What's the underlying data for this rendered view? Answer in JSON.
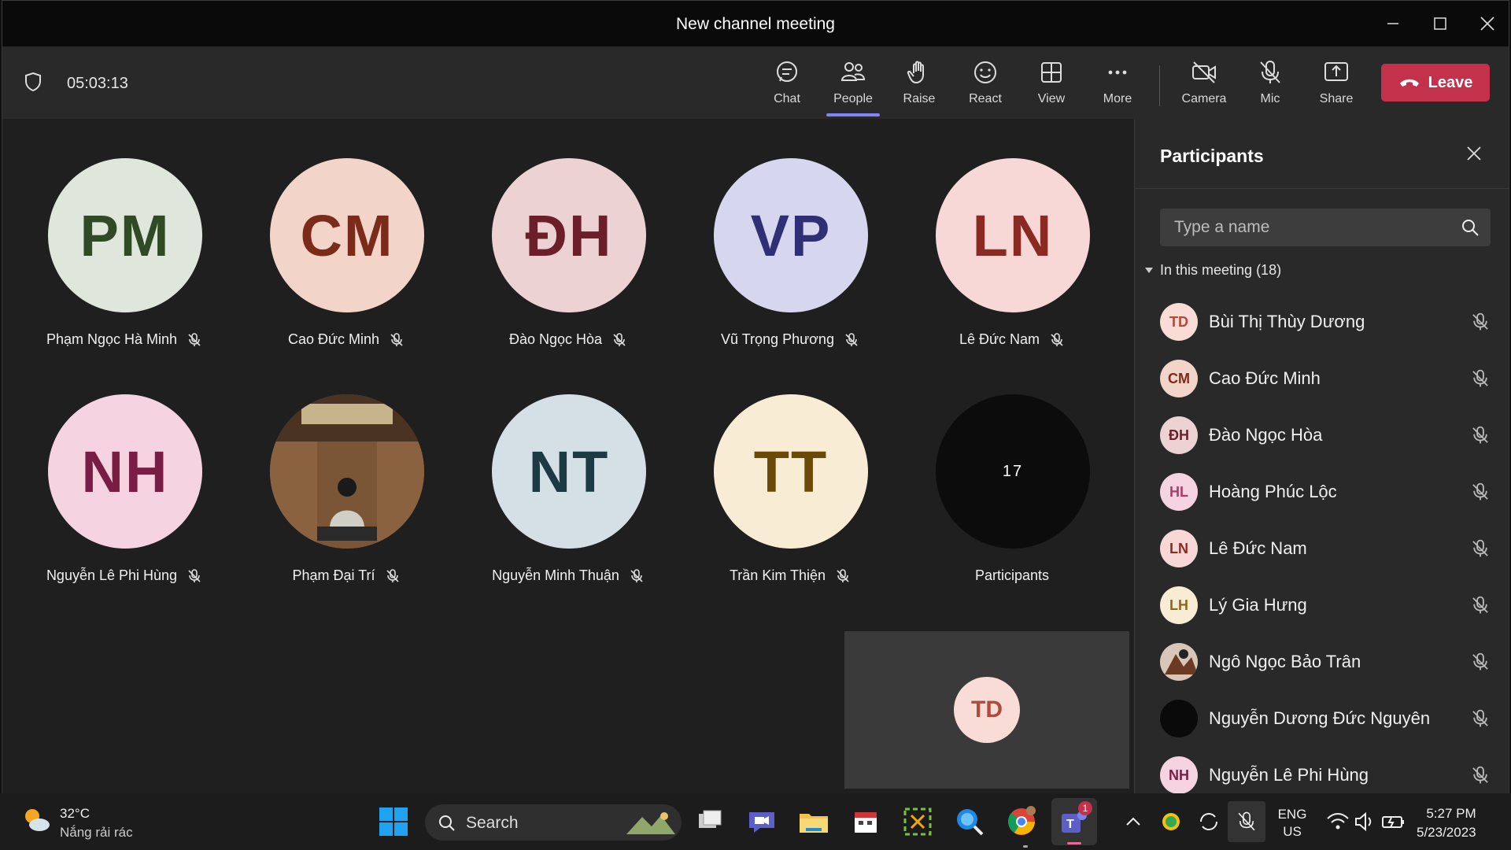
{
  "window": {
    "title": "New channel meeting"
  },
  "toolbar": {
    "timer": "05:03:13",
    "buttons": [
      {
        "label": "Chat",
        "icon": "chat-icon"
      },
      {
        "label": "People",
        "icon": "people-icon"
      },
      {
        "label": "Raise",
        "icon": "hand-icon"
      },
      {
        "label": "React",
        "icon": "smile-icon"
      },
      {
        "label": "View",
        "icon": "grid-icon"
      },
      {
        "label": "More",
        "icon": "more-icon"
      },
      {
        "label": "Camera",
        "icon": "camera-off-icon"
      },
      {
        "label": "Mic",
        "icon": "mic-off-icon"
      },
      {
        "label": "Share",
        "icon": "share-icon"
      }
    ],
    "leave_label": "Leave"
  },
  "stage": {
    "tiles": [
      {
        "initials": "PM",
        "name": "Phạm Ngọc Hà Minh",
        "bg": "#dfe6dc",
        "fg": "#2f4a24"
      },
      {
        "initials": "CM",
        "name": "Cao Đức Minh",
        "bg": "#f3d4c9",
        "fg": "#7a2b19"
      },
      {
        "initials": "ĐH",
        "name": "Đào Ngọc Hòa",
        "bg": "#ecd2d3",
        "fg": "#6a1f2a"
      },
      {
        "initials": "VP",
        "name": "Vũ Trọng Phương",
        "bg": "#d6d6ee",
        "fg": "#2f2f75"
      },
      {
        "initials": "LN",
        "name": "Lê Đức Nam",
        "bg": "#f8d8d6",
        "fg": "#8a2a22"
      },
      {
        "initials": "NH",
        "name": "Nguyễn Lê Phi Hùng",
        "bg": "#f6d3e1",
        "fg": "#7a1d44"
      },
      {
        "initials": "",
        "name": "Phạm Đại Trí",
        "bg": "#6b4a2e",
        "fg": "#fff"
      },
      {
        "initials": "NT",
        "name": "Nguyễn Minh Thuận",
        "bg": "#d4e0e6",
        "fg": "#1c3a44"
      },
      {
        "initials": "TT",
        "name": "Trần Kim Thiện",
        "bg": "#f8ecd4",
        "fg": "#6a4a06"
      },
      {
        "initials": "17",
        "name": "Participants",
        "bg": "#0c0c0c",
        "fg": "#fff"
      }
    ],
    "self_initials": "TD"
  },
  "panel": {
    "title": "Participants",
    "search_placeholder": "Type a name",
    "section_label": "In this meeting (18)",
    "participants": [
      {
        "initials": "TD",
        "name": "Bùi Thị Thùy Dương",
        "bg": "#f8dcd5",
        "fg": "#b04a3e"
      },
      {
        "initials": "CM",
        "name": "Cao Đức Minh",
        "bg": "#f3d4c9",
        "fg": "#7a2b19"
      },
      {
        "initials": "ĐH",
        "name": "Đào Ngọc Hòa",
        "bg": "#ecd2d3",
        "fg": "#6a1f2a"
      },
      {
        "initials": "HL",
        "name": "Hoàng Phúc Lộc",
        "bg": "#f6d3e1",
        "fg": "#b03a6a"
      },
      {
        "initials": "LN",
        "name": "Lê Đức Nam",
        "bg": "#f8d8d6",
        "fg": "#8a2a22"
      },
      {
        "initials": "LH",
        "name": "Lý Gia Hưng",
        "bg": "#f8ecd4",
        "fg": "#8a6a1e"
      },
      {
        "initials": "",
        "name": "Ngô Ngọc Bảo Trân",
        "bg": "#5a3a2a",
        "fg": "#fff"
      },
      {
        "initials": "",
        "name": "Nguyễn Dương Đức Nguyên",
        "bg": "#0a0a0a",
        "fg": "#fff"
      },
      {
        "initials": "NH",
        "name": "Nguyễn Lê Phi Hùng",
        "bg": "#f6d3e1",
        "fg": "#7a1d44"
      }
    ]
  },
  "taskbar": {
    "weather_temp": "32°C",
    "weather_desc": "Nắng rải rác",
    "search_label": "Search",
    "lang_top": "ENG",
    "lang_bottom": "US",
    "time": "5:27 PM",
    "date": "5/23/2023",
    "teams_badge": "1"
  },
  "colors": {
    "accent": "#7f85f5",
    "leave": "#c4314b"
  }
}
